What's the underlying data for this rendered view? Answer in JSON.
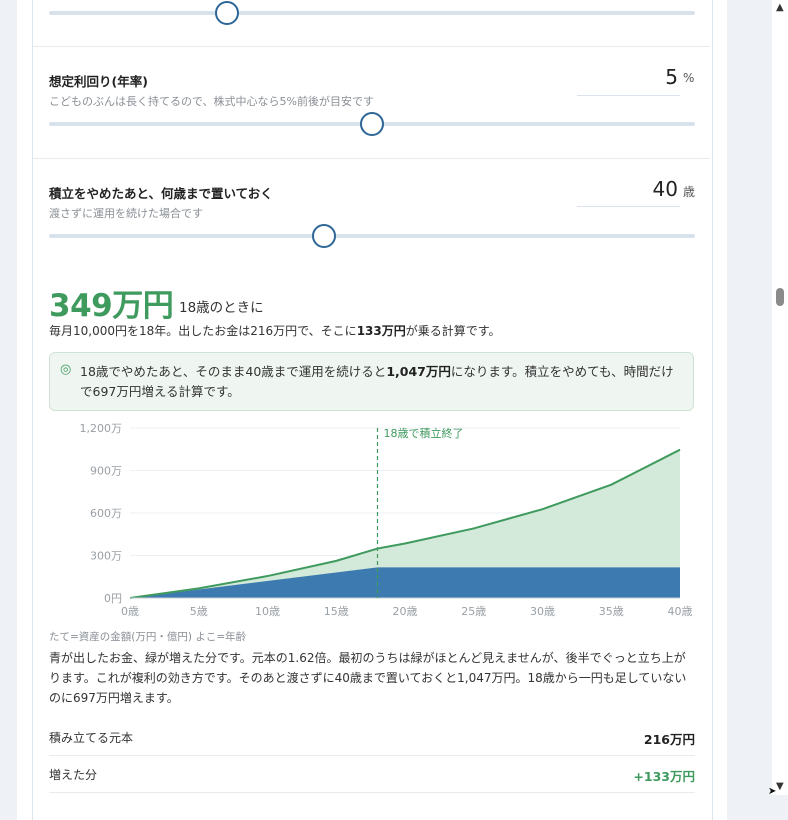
{
  "fields": [
    {
      "id": "yield",
      "label": "想定利回り(年率)",
      "help": "こどものぶんは長く持てるので、株式中心なら5%前後が目安です",
      "value": "5",
      "unit": "%",
      "slider_fraction": 0.5
    },
    {
      "id": "hold_until",
      "label": "積立をやめたあと、何歳まで置いておく",
      "help": "渡さずに運用を続けた場合です",
      "value": "40",
      "unit": "歳",
      "slider_fraction": 0.425
    }
  ],
  "top_slider_fraction": 0.275,
  "result": {
    "amount": "349万円",
    "age_note": "18歳のときに",
    "summary_pre": "毎月10,000円を18年。出したお金は216万円で、そこに",
    "summary_bold": "133万円",
    "summary_post": "が乗る計算です。"
  },
  "note": {
    "icon": "◎",
    "pre": "18歳でやめたあと、そのまま40歳まで運用を続けると",
    "bold": "1,047万円",
    "post": "になります。積立をやめても、時間だけで697万円増える計算です。"
  },
  "chart_data": {
    "type": "area",
    "x_label_suffix": "歳",
    "x_ticks": [
      "0歳",
      "5歳",
      "10歳",
      "15歳",
      "20歳",
      "25歳",
      "30歳",
      "35歳",
      "40歳"
    ],
    "y_ticks": [
      "0円",
      "300万",
      "600万",
      "900万",
      "1,200万"
    ],
    "ylim": [
      0,
      1200
    ],
    "xlim": [
      0,
      40
    ],
    "annotation": "18歳で積立終了",
    "annotation_x": 18,
    "series": [
      {
        "name": "出したお金",
        "color": "#3d7ab0",
        "x": [
          0,
          18,
          40
        ],
        "y": [
          0,
          216,
          216
        ]
      },
      {
        "name": "増えた分",
        "color": "#3f9a5e",
        "fill": "#d3e9da",
        "x": [
          0,
          5,
          10,
          15,
          18,
          20,
          25,
          30,
          35,
          40
        ],
        "y": [
          0,
          68,
          155,
          262,
          349,
          385,
          491,
          627,
          800,
          1047
        ]
      }
    ]
  },
  "chart_caption": "たて=資産の金額(万円・億円) よこ=年齢",
  "explanation": "青が出したお金、緑が増えた分です。元本の1.62倍。最初のうちは緑がほとんど見えませんが、後半でぐっと立ち上がります。これが複利の効き方です。そのあと渡さずに40歳まで置いておくと1,047万円。18歳から一円も足していないのに697万円増えます。",
  "table": [
    {
      "label": "積み立てる元本",
      "value": "216万円",
      "tone": "normal"
    },
    {
      "label": "増えた分",
      "value": "+133万円",
      "tone": "green"
    }
  ],
  "colors": {
    "accent_green": "#3f9a5e",
    "principal_blue": "#3d7ab0",
    "slider_knob": "#2c6696"
  }
}
